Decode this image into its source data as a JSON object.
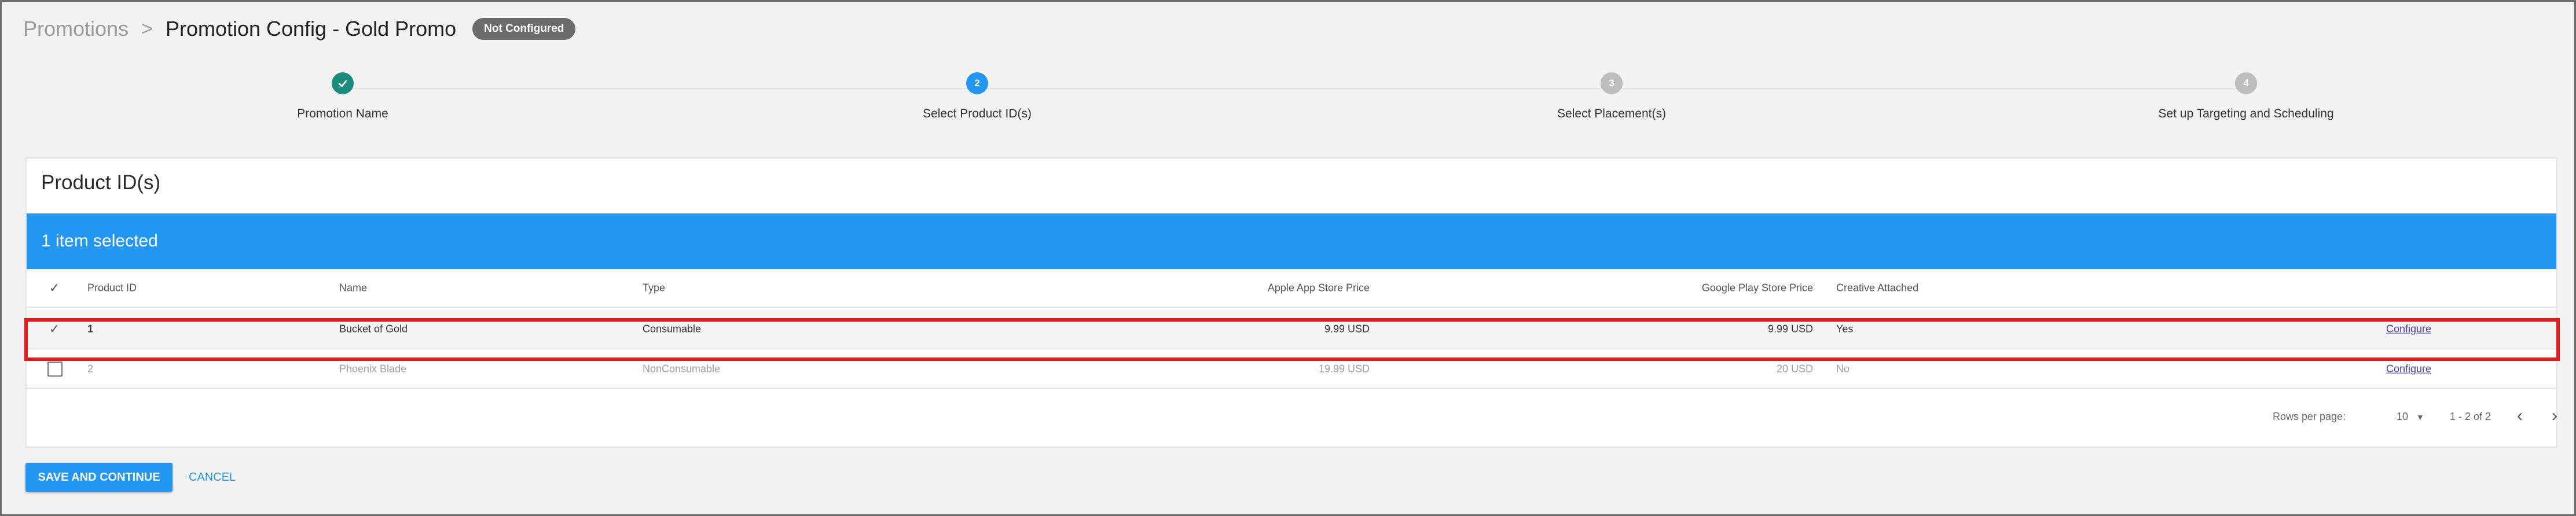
{
  "breadcrumb": {
    "parent": "Promotions",
    "separator": ">",
    "title": "Promotion Config - Gold Promo",
    "status": "Not Configured"
  },
  "stepper": {
    "steps": [
      {
        "number": "1",
        "label": "Promotion Name",
        "state": "done"
      },
      {
        "number": "2",
        "label": "Select Product ID(s)",
        "state": "active"
      },
      {
        "number": "3",
        "label": "Select Placement(s)",
        "state": "pending"
      },
      {
        "number": "4",
        "label": "Set up Targeting and Scheduling",
        "state": "pending"
      }
    ]
  },
  "card": {
    "title": "Product ID(s)",
    "selection_text": "1 item selected"
  },
  "table": {
    "headers": {
      "product_id": "Product ID",
      "name": "Name",
      "type": "Type",
      "apple_price": "Apple App Store Price",
      "google_price": "Google Play Store Price",
      "creative": "Creative Attached"
    },
    "rows": [
      {
        "selected": true,
        "product_id": "1",
        "name": "Bucket of Gold",
        "type": "Consumable",
        "apple_price": "9.99 USD",
        "google_price": "9.99 USD",
        "creative": "Yes",
        "action": "Configure"
      },
      {
        "selected": false,
        "product_id": "2",
        "name": "Phoenix Blade",
        "type": "NonConsumable",
        "apple_price": "19.99 USD",
        "google_price": "20 USD",
        "creative": "No",
        "action": "Configure"
      }
    ]
  },
  "pagination": {
    "rows_per_page_label": "Rows per page:",
    "rows_per_page": "10",
    "range": "1 - 2 of 2"
  },
  "footer": {
    "save_label": "SAVE AND CONTINUE",
    "cancel_label": "CANCEL"
  },
  "colors": {
    "accent": "#2196f3",
    "done": "#1b8c79",
    "highlight": "#e51a1a"
  }
}
